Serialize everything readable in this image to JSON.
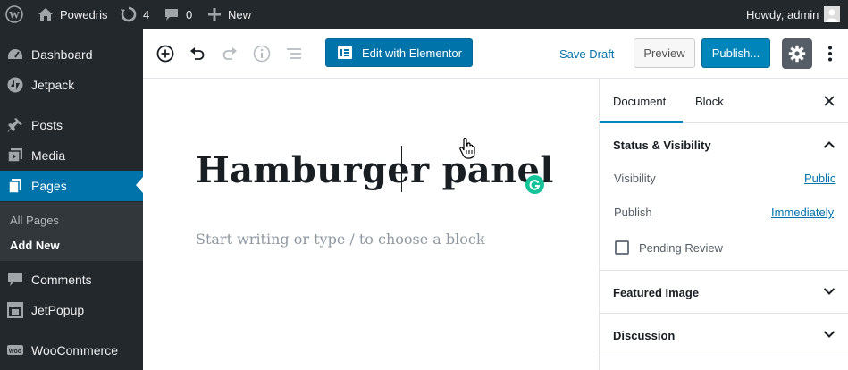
{
  "admin_bar": {
    "site_name": "Powedris",
    "updates_count": "4",
    "comments_count": "0",
    "new_label": "New",
    "greeting": "Howdy, admin"
  },
  "sidebar": {
    "items": [
      {
        "label": "Dashboard",
        "icon": "dashboard-icon"
      },
      {
        "label": "Jetpack",
        "icon": "jetpack-icon"
      },
      {
        "label": "Posts",
        "icon": "pin-icon"
      },
      {
        "label": "Media",
        "icon": "media-icon"
      },
      {
        "label": "Pages",
        "icon": "pages-icon",
        "current": true
      },
      {
        "label": "Comments",
        "icon": "comments-icon"
      },
      {
        "label": "JetPopup",
        "icon": "jetpopup-icon"
      },
      {
        "label": "WooCommerce",
        "icon": "woocommerce-icon"
      }
    ],
    "submenu": [
      {
        "label": "All Pages"
      },
      {
        "label": "Add New",
        "active": true
      }
    ]
  },
  "toolbar": {
    "elementor_label": "Edit with Elementor",
    "save_draft_label": "Save Draft",
    "preview_label": "Preview",
    "publish_label": "Publish..."
  },
  "editor": {
    "title": "Hamburger panel",
    "placeholder": "Start writing or type / to choose a block"
  },
  "panel": {
    "tabs": [
      {
        "label": "Document",
        "active": true
      },
      {
        "label": "Block"
      }
    ],
    "status_section": "Status & Visibility",
    "visibility_label": "Visibility",
    "visibility_value": "Public",
    "publish_label": "Publish",
    "publish_value": "Immediately",
    "pending_review_label": "Pending Review",
    "pending_review_checked": false,
    "featured_image_section": "Featured Image",
    "discussion_section": "Discussion"
  },
  "colors": {
    "admin_dark": "#23282d",
    "wp_blue": "#0073aa",
    "publish_blue": "#0085ba",
    "grammarly_green": "#15c39a"
  }
}
